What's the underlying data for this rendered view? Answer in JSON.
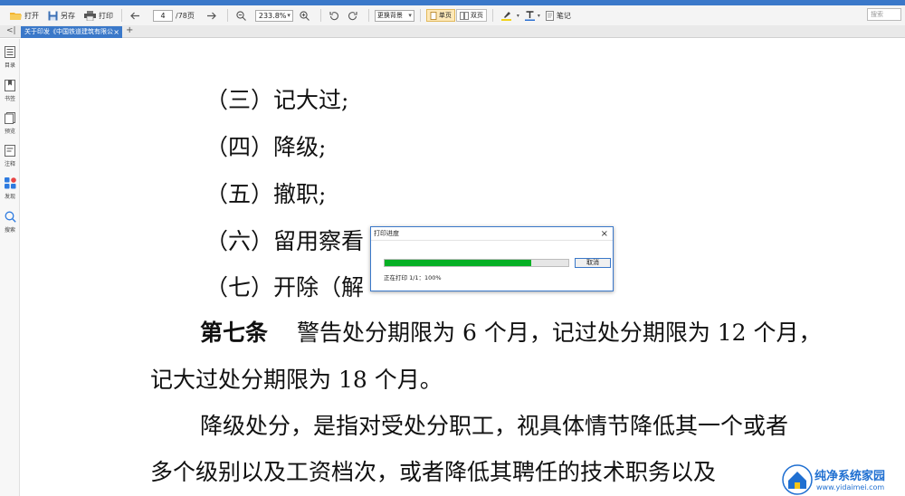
{
  "app": {
    "title": ""
  },
  "toolbar": {
    "open_label": "打开",
    "saveas_label": "另存",
    "print_label": "打印",
    "page_current": "4",
    "page_total": "/78页",
    "zoom_value": "233.8%",
    "background_label": "更换背景",
    "single_page_label": "单页",
    "double_page_label": "双页",
    "note_label": "笔记",
    "search_placeholder": "搜索"
  },
  "tabs": {
    "active_title": "关于印发《中国铁道建筑有限公"
  },
  "sidebar": {
    "items": [
      {
        "label": "目录",
        "icon": "toc-icon"
      },
      {
        "label": "书签",
        "icon": "bookmark-icon"
      },
      {
        "label": "预览",
        "icon": "thumbnail-icon"
      },
      {
        "label": "注释",
        "icon": "annotation-icon"
      },
      {
        "label": "发现",
        "icon": "discover-icon"
      },
      {
        "label": "搜索",
        "icon": "search-icon"
      }
    ]
  },
  "document": {
    "lines": [
      "（三）记大过;",
      "（四）降级;",
      "（五）撤职;",
      "（六）留用察看",
      "（七）开除（解",
      "警告处分期限为 6 个月，记过处分期限为 12 个月，",
      "记大过处分期限为 18 个月。",
      "降级处分，是指对受处分职工，视具体情节降低其一个或者",
      "多个级别以及工资档次，或者降低其聘任的技术职务以及"
    ],
    "article_heading": "第七条"
  },
  "dialog": {
    "title": "打印进度",
    "cancel_label": "取消",
    "status_text": "正在打印 1/1：100%",
    "progress": 0.8
  },
  "watermark": {
    "name": "纯净系统家园",
    "url": "www.yidaimei.com"
  },
  "colors": {
    "accent": "#3a78c9",
    "progress": "#06b025",
    "active_view": "#fde8b8"
  }
}
